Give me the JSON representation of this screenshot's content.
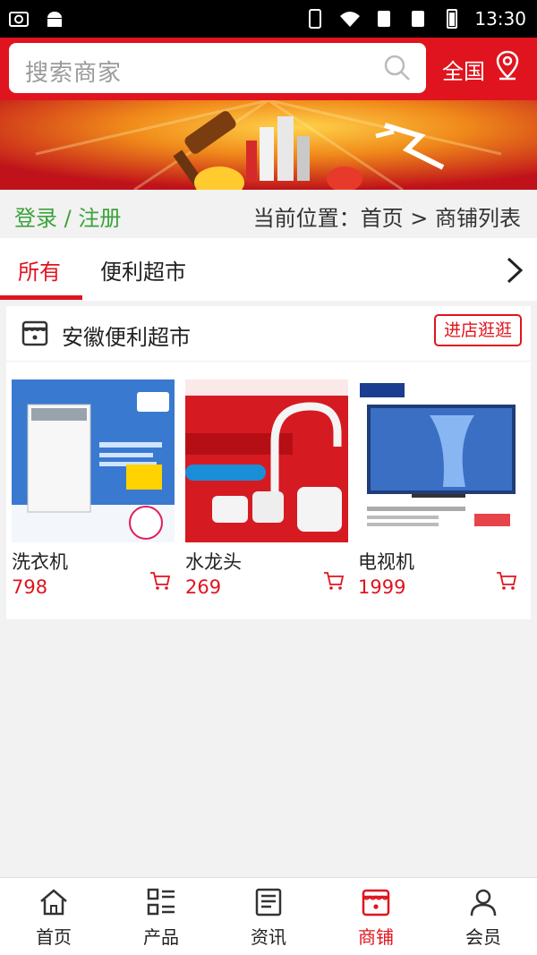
{
  "status_bar": {
    "time": "13:30"
  },
  "search": {
    "placeholder": "搜索商家"
  },
  "region": {
    "label": "全国"
  },
  "user": {
    "login_link": "登录 / 注册"
  },
  "breadcrumb": {
    "text": "当前位置：首页 > 商铺列表"
  },
  "tabs": [
    {
      "label": "所有",
      "active": true
    },
    {
      "label": "便利超市",
      "active": false
    }
  ],
  "shop": {
    "name": "安徽便利超市",
    "visit_label": "进店逛逛",
    "products": [
      {
        "name": "洗衣机",
        "price": "798"
      },
      {
        "name": "水龙头",
        "price": "269"
      },
      {
        "name": "电视机",
        "price": "1999"
      }
    ]
  },
  "bottom_nav": [
    {
      "label": "首页",
      "icon": "home-icon"
    },
    {
      "label": "产品",
      "icon": "grid-list-icon"
    },
    {
      "label": "资讯",
      "icon": "news-icon"
    },
    {
      "label": "商铺",
      "icon": "shop-icon",
      "active": true
    },
    {
      "label": "会员",
      "icon": "user-icon"
    }
  ],
  "colors": {
    "brand": "#e0141e",
    "login_green": "#3ba33b"
  }
}
